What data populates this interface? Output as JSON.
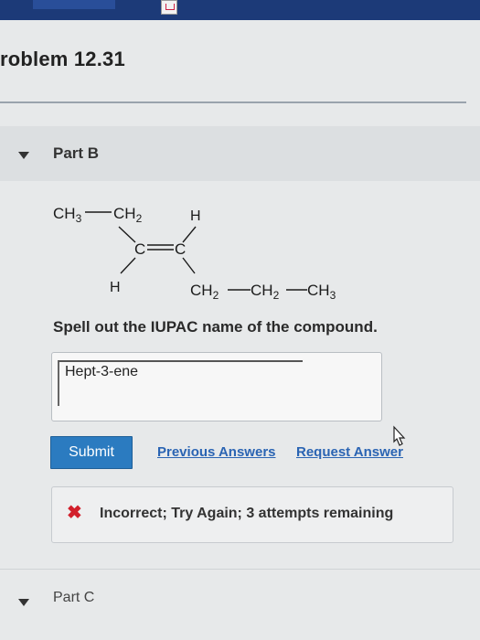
{
  "header": {
    "title": "roblem 12.31"
  },
  "part_b": {
    "label": "Part B",
    "molecule": {
      "top_left": "CH",
      "top_left_sub": "3",
      "top_left_b": "CH",
      "top_left_b_sub": "2",
      "top_right": "H",
      "c_left": "C",
      "c_right": "C",
      "bottom_left": "H",
      "bottom_right_1": "CH",
      "bottom_right_1_sub": "2",
      "bottom_right_2": "CH",
      "bottom_right_2_sub": "2",
      "bottom_right_3": "CH",
      "bottom_right_3_sub": "3"
    },
    "question": "Spell out the IUPAC name of the compound.",
    "answer_value": "Hept-3-ene",
    "submit_label": "Submit",
    "previous_answers_label": "Previous Answers",
    "request_answer_label": "Request Answer",
    "feedback": {
      "icon": "x-icon",
      "text": "Incorrect; Try Again; 3 attempts remaining",
      "color": "#d21f2b"
    }
  },
  "part_c": {
    "label": "Part C"
  },
  "colors": {
    "accent": "#2b7bc0",
    "link": "#2a64b3",
    "topbar": "#1c3a78"
  }
}
